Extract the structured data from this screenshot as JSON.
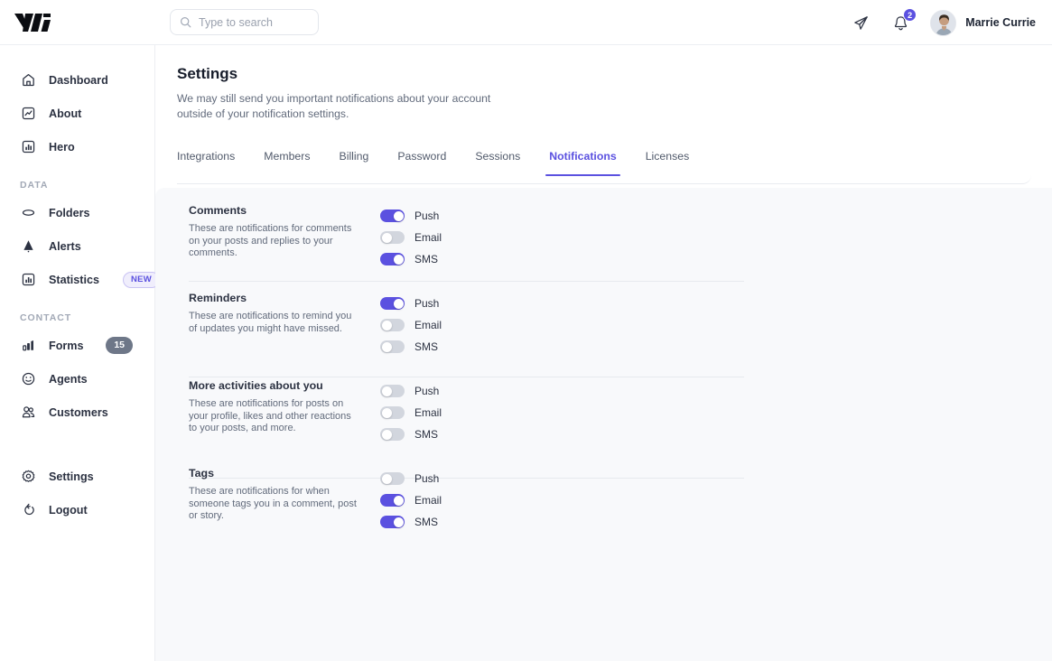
{
  "header": {
    "logo_icon": "vi-logo",
    "search": {
      "placeholder": "Type to search",
      "value": "",
      "icon": "search-icon"
    },
    "send_icon": "paper-plane-icon",
    "bell_icon": "bell-icon",
    "notification_count": "2",
    "user": {
      "name": "Marrie Currie",
      "avatar_icon": "user-avatar"
    }
  },
  "sidebar": {
    "items": [
      {
        "label": "Dashboard",
        "icon": "home-icon"
      },
      {
        "label": "About",
        "icon": "chart-line-icon"
      },
      {
        "label": "Hero",
        "icon": "bar-chart-icon"
      }
    ],
    "sections": [
      {
        "title": "DATA",
        "items": [
          {
            "label": "Folders",
            "icon": "folder-icon",
            "badge": null,
            "badge_type": null
          },
          {
            "label": "Alerts",
            "icon": "alert-triangle-icon",
            "badge": null,
            "badge_type": null
          },
          {
            "label": "Statistics",
            "icon": "bar-chart-icon",
            "badge": "NEW",
            "badge_type": "new"
          }
        ]
      },
      {
        "title": "CONTACT",
        "items": [
          {
            "label": "Forms",
            "icon": "forms-bar-icon",
            "badge": "15",
            "badge_type": "count"
          },
          {
            "label": "Agents",
            "icon": "smiley-icon",
            "badge": null,
            "badge_type": null
          },
          {
            "label": "Customers",
            "icon": "users-icon",
            "badge": null,
            "badge_type": null
          }
        ]
      }
    ],
    "footer_items": [
      {
        "label": "Settings",
        "icon": "gear-icon"
      },
      {
        "label": "Logout",
        "icon": "logout-icon"
      }
    ]
  },
  "main": {
    "title": "Settings",
    "subtitle": "We may still send you important notifications about your account outside of your notification settings.",
    "tabs": [
      {
        "label": "Integrations",
        "active": false
      },
      {
        "label": "Members",
        "active": false
      },
      {
        "label": "Billing",
        "active": false
      },
      {
        "label": "Password",
        "active": false
      },
      {
        "label": "Sessions",
        "active": false
      },
      {
        "label": "Notifications",
        "active": true
      },
      {
        "label": "Licenses",
        "active": false
      }
    ],
    "groups": [
      {
        "title": "Comments",
        "description": "These are notifications for comments on your posts and replies to your comments.",
        "toggles": [
          {
            "label": "Push",
            "on": true
          },
          {
            "label": "Email",
            "on": false
          },
          {
            "label": "SMS",
            "on": true
          }
        ]
      },
      {
        "title": "Reminders",
        "description": "These are notifications to remind you of updates you might have missed.",
        "toggles": [
          {
            "label": "Push",
            "on": true
          },
          {
            "label": "Email",
            "on": false
          },
          {
            "label": "SMS",
            "on": false
          }
        ]
      },
      {
        "title": "More activities about you",
        "description": "These are notifications for posts on your profile, likes and other reactions to your posts, and more.",
        "toggles": [
          {
            "label": "Push",
            "on": false
          },
          {
            "label": "Email",
            "on": false
          },
          {
            "label": "SMS",
            "on": false
          }
        ]
      },
      {
        "title": "Tags",
        "description": "These are notifications for when someone tags you in a comment, post or story.",
        "toggles": [
          {
            "label": "Push",
            "on": false
          },
          {
            "label": "Email",
            "on": true
          },
          {
            "label": "SMS",
            "on": true
          }
        ]
      }
    ]
  },
  "colors": {
    "accent": "#5b51e0",
    "panel_bg": "#f8f9fb",
    "text": "#2c3242",
    "muted": "#626b7c",
    "badge_gray": "#6e7788"
  }
}
